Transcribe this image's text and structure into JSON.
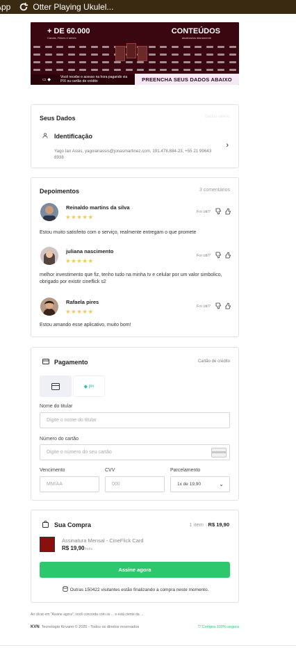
{
  "topbar": {
    "left_text": "App",
    "right_text": "Otter Playing Ukulel..."
  },
  "banner": {
    "headline_left": "+ DE 60.000",
    "sub_left": "Canais, Filmes e séries",
    "headline_right": "CONTEÚDOS",
    "sub_right": "atualizados diariamente",
    "payment_text": "Você recebe o acesso na hora pagando via PIX ou cartão de crédito",
    "cta": "PREENCHA SEUS DADOS ABAIXO"
  },
  "seus_dados": {
    "title": "Seus Dados",
    "faint_right": "Dados salvos",
    "identification_label": "Identificação",
    "identification_text": "Yago Ian Assis, yagoianassis@jonasmartinez.com, 191.478.884-23, +55 21 99643 8938"
  },
  "depoimentos": {
    "title": "Depoimentos",
    "count": "3 comentários",
    "useful_label": "Foi útil?",
    "reviews": [
      {
        "name": "Reinaldo martins da silva",
        "stars": "★★★★★",
        "text": "Estou muito satisfeito com o serviço, realmente entregam o que promete"
      },
      {
        "name": "juliana nascimento",
        "stars": "★★★★★",
        "text": "melhor investimento que fiz, tenho tudo na minha tv e celular por um valor simbolico, obrigado por existir cineflick s2"
      },
      {
        "name": "Rafaela pires",
        "stars": "★★★★★",
        "text": "Estou amando esse aplicativo, muito bom!"
      }
    ]
  },
  "pagamento": {
    "title": "Pagamento",
    "method_label": "Cartão de crédito",
    "pix_label": "pix",
    "holder_label": "Nome do titular",
    "holder_placeholder": "Digite o nome do titular",
    "card_label": "Número do cartão",
    "card_placeholder": "Digite o número do seu cartão",
    "expiry_label": "Vencimento",
    "expiry_placeholder": "MM/AA",
    "cvv_label": "CVV",
    "cvv_placeholder": "000",
    "installments_label": "Parcelamento",
    "installments_value": "1x de 19,90"
  },
  "compra": {
    "title": "Sua Compra",
    "summary_items": "1 item ·",
    "summary_price": "R$ 19,90",
    "product_name": "Assinatura Mensal - CineFlick Card",
    "product_price": "R$ 19,90",
    "product_period": "/mês",
    "buy_button": "Assine agora",
    "visitors_text": "Outras 150422 visitantes estão finalizando a compra neste momento."
  },
  "footer": {
    "legal": "Ao clicar em \"Assine agora\", você concorda com os ... e está ciente da ...",
    "brand": "KVN",
    "copyright": "Tecnologia Kirvano © 2025 - Todos os direitos reservados",
    "secure": "Compra 100% segura"
  }
}
